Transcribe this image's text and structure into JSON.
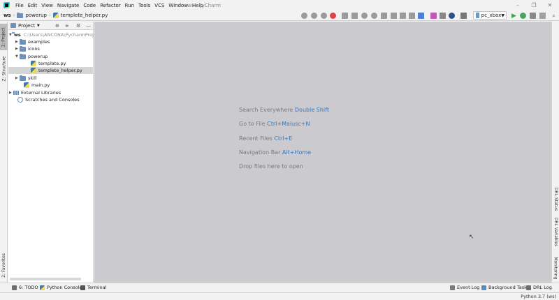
{
  "window": {
    "title": "ws - PyCharm"
  },
  "menu": [
    "File",
    "Edit",
    "View",
    "Navigate",
    "Code",
    "Refactor",
    "Run",
    "Tools",
    "VCS",
    "Window",
    "Help"
  ],
  "breadcrumb": {
    "root": "ws",
    "folder": "powerup",
    "file": "templete_helper.py"
  },
  "run_config": {
    "name": "pc_xbox"
  },
  "left_tabs": {
    "project": "1: Project",
    "structure": "Z: Structure",
    "favorites": "2: Favorites"
  },
  "right_tabs": {
    "drl_status": "DRL Status",
    "drl_variables": "DRL Variables",
    "monitoring": "Monitoring"
  },
  "project_panel": {
    "title": "Project",
    "tree": [
      {
        "label": "ws",
        "path": "C:\\Users\\ANCONA\\PycharmProje",
        "icon": "folder-icon",
        "arrow": "▼"
      },
      {
        "label": "examples",
        "icon": "folder-icon",
        "arrow": "▶"
      },
      {
        "label": "icons",
        "icon": "folder-icon",
        "arrow": "▶"
      },
      {
        "label": "powerup",
        "icon": "folder-icon",
        "arrow": "▼"
      },
      {
        "label": "template.py",
        "icon": "python-file-icon",
        "arrow": ""
      },
      {
        "label": "templete_helper.py",
        "icon": "python-file-icon",
        "arrow": "",
        "selected": true
      },
      {
        "label": "skill",
        "icon": "folder-icon",
        "arrow": "▶"
      },
      {
        "label": "main.py",
        "icon": "python-file-icon",
        "arrow": ""
      },
      {
        "label": "External Libraries",
        "icon": "library-icon",
        "arrow": "▶"
      },
      {
        "label": "Scratches and Consoles",
        "icon": "scratch-icon",
        "arrow": ""
      }
    ]
  },
  "editor_hints": [
    {
      "text": "Search Everywhere",
      "key": "Double Shift"
    },
    {
      "text": "Go to File",
      "key": "Ctrl+Maiusc+N"
    },
    {
      "text": "Recent Files",
      "key": "Ctrl+E"
    },
    {
      "text": "Navigation Bar",
      "key": "Alt+Home"
    },
    {
      "text": "Drop files here to open",
      "key": ""
    }
  ],
  "bottom_tabs": {
    "todo": "6: TODO",
    "python_console": "Python Console",
    "terminal": "Terminal",
    "event_log": "Event Log",
    "background_task": "Background Task",
    "drl_log": "DRL Log"
  },
  "status": {
    "interpreter": "Python 3.7 (ws)"
  },
  "colors": {
    "editor_bg": "#cbcacf",
    "key_link": "#3a79b6",
    "selection": "#d5d5d5",
    "run_green": "#3fa34d"
  }
}
